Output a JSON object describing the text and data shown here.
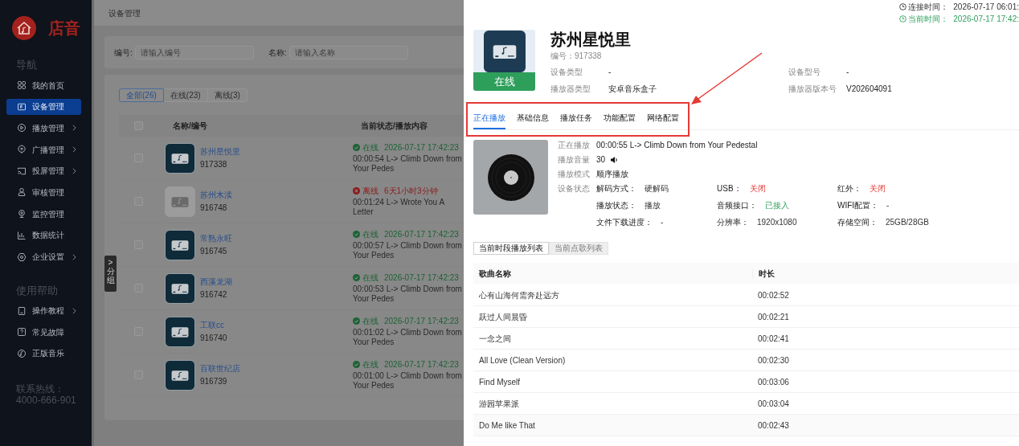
{
  "sidebar": {
    "logo_text": "店音",
    "sections": [
      {
        "title": "导航",
        "items": [
          {
            "label": "我的首页",
            "selected": false,
            "expandable": false
          },
          {
            "label": "设备管理",
            "selected": true,
            "expandable": false
          },
          {
            "label": "播放管理",
            "selected": false,
            "expandable": true
          },
          {
            "label": "广播管理",
            "selected": false,
            "expandable": true
          },
          {
            "label": "投屏管理",
            "selected": false,
            "expandable": true
          },
          {
            "label": "审核管理",
            "selected": false,
            "expandable": false
          },
          {
            "label": "监控管理",
            "selected": false,
            "expandable": false
          },
          {
            "label": "数据统计",
            "selected": false,
            "expandable": false
          },
          {
            "label": "企业设置",
            "selected": false,
            "expandable": true
          }
        ]
      },
      {
        "title": "使用帮助",
        "items": [
          {
            "label": "操作教程",
            "selected": false,
            "expandable": true
          },
          {
            "label": "常见故障",
            "selected": false,
            "expandable": false
          },
          {
            "label": "正版音乐",
            "selected": false,
            "expandable": false
          }
        ]
      }
    ],
    "hotline": "联系热线：4000-666-901"
  },
  "main": {
    "breadcrumb": "设备管理",
    "filters": [
      {
        "label": "编号:",
        "placeholder": "请输入编号"
      },
      {
        "label": "名称:",
        "placeholder": "请输入名称"
      }
    ],
    "status_tabs": [
      {
        "label": "全部(26)",
        "selected": true
      },
      {
        "label": "在线(23)",
        "selected": false
      },
      {
        "label": "离线(3)",
        "selected": false
      }
    ],
    "group_toggle": {
      "arrow": ">",
      "label": "分组"
    },
    "table": {
      "select_all_checked": false,
      "columns": [
        "名称/编号",
        "当前状态/播放内容"
      ],
      "rows": [
        {
          "checked": false,
          "kind": "online",
          "name": "苏州星悦里",
          "code": "917338",
          "status_label": "在线",
          "status_time": "2026-07-17 17:42:23",
          "playing": "00:00:54 L-> Climb Down from Your Pedes"
        },
        {
          "checked": false,
          "kind": "offline",
          "name": "苏州木渎",
          "code": "916748",
          "status_label": "离线",
          "status_time": "6天1小时3分钟",
          "playing": "00:01:24 L-> Wrote You A Letter"
        },
        {
          "checked": false,
          "kind": "online",
          "name": "常熟永旺",
          "code": "916745",
          "status_label": "在线",
          "status_time": "2026-07-17 17:42:23",
          "playing": "00:00:57 L-> Climb Down from Your Pedes"
        },
        {
          "checked": false,
          "kind": "online",
          "name": "西溪龙湖",
          "code": "916742",
          "status_label": "在线",
          "status_time": "2026-07-17 17:42:23",
          "playing": "00:00:53 L-> Climb Down from Your Pedes"
        },
        {
          "checked": false,
          "kind": "online",
          "name": "工联cc",
          "code": "916740",
          "status_label": "在线",
          "status_time": "2026-07-17 17:42:23",
          "playing": "00:01:02 L-> Climb Down from Your Pedes"
        },
        {
          "checked": false,
          "kind": "online",
          "name": "百联世纪店",
          "code": "916739",
          "status_label": "在线",
          "status_time": "2026-07-17 17:42:23",
          "playing": "00:01:00 L-> Climb Down from Your Pedes"
        }
      ]
    }
  },
  "drawer": {
    "times": [
      {
        "label": "连接时间：",
        "value": "2026-07-17 06:01:",
        "kind": "normal"
      },
      {
        "label": "当前时间：",
        "value": "2026-07-17 17:42:",
        "kind": "ok"
      }
    ],
    "device": {
      "name": "苏州星悦里",
      "code": "编号：917338",
      "kind": "online",
      "status_label": "在线",
      "info": [
        {
          "label": "设备类型",
          "value": "-"
        },
        {
          "label": "设备型号",
          "value": "-"
        },
        {
          "label": "播放器类型",
          "value": "安卓音乐盒子"
        },
        {
          "label": "播放器版本号",
          "value": "V202604091"
        }
      ]
    },
    "tabs": [
      {
        "label": "正在播放",
        "selected": true
      },
      {
        "label": "基础信息",
        "selected": false
      },
      {
        "label": "播放任务",
        "selected": false
      },
      {
        "label": "功能配置",
        "selected": false
      },
      {
        "label": "网络配置",
        "selected": false
      }
    ],
    "now_playing": [
      {
        "kind": "text",
        "label": "正在播放",
        "value": "00:00:55 L-> Climb Down from Your Pedestal"
      },
      {
        "kind": "volume",
        "label": "播放音量",
        "value": "30"
      },
      {
        "kind": "text",
        "label": "播放模式",
        "value": "顺序播放"
      }
    ],
    "device_status": {
      "label": "设备状态",
      "items": [
        {
          "label": "解码方式：",
          "value": "硬解码",
          "kind": "normal"
        },
        {
          "label": "USB：",
          "value": "关闭",
          "kind": "alert"
        },
        {
          "label": "红外：",
          "value": "关闭",
          "kind": "alert"
        },
        {
          "label": "播放状态：",
          "value": "播放",
          "kind": "normal"
        },
        {
          "label": "音频接口：",
          "value": "已接入",
          "kind": "ok"
        },
        {
          "label": "WIFI配置：",
          "value": "-",
          "kind": "normal"
        },
        {
          "label": "文件下载进度：",
          "value": "-",
          "kind": "normal"
        },
        {
          "label": "分辨率：",
          "value": "1920x1080",
          "kind": "normal"
        },
        {
          "label": "存储空间：",
          "value": "25GB/28GB",
          "kind": "normal"
        }
      ]
    },
    "list_tabs": [
      {
        "label": "当前时段播放列表",
        "selected": true
      },
      {
        "label": "当前点歌列表",
        "selected": false
      }
    ],
    "songs": {
      "columns": [
        "歌曲名称",
        "时长"
      ],
      "rows": [
        [
          "心有山海何需奔赴远方",
          "00:02:52"
        ],
        [
          "跃过人间晨昏",
          "00:02:21"
        ],
        [
          "一念之间",
          "00:02:41"
        ],
        [
          "All Love (Clean Version)",
          "00:02:30"
        ],
        [
          "Find Myself",
          "00:03:06"
        ],
        [
          "游园苹果派",
          "00:03:04"
        ],
        [
          "Do Me like That",
          "00:02:43"
        ]
      ]
    }
  }
}
